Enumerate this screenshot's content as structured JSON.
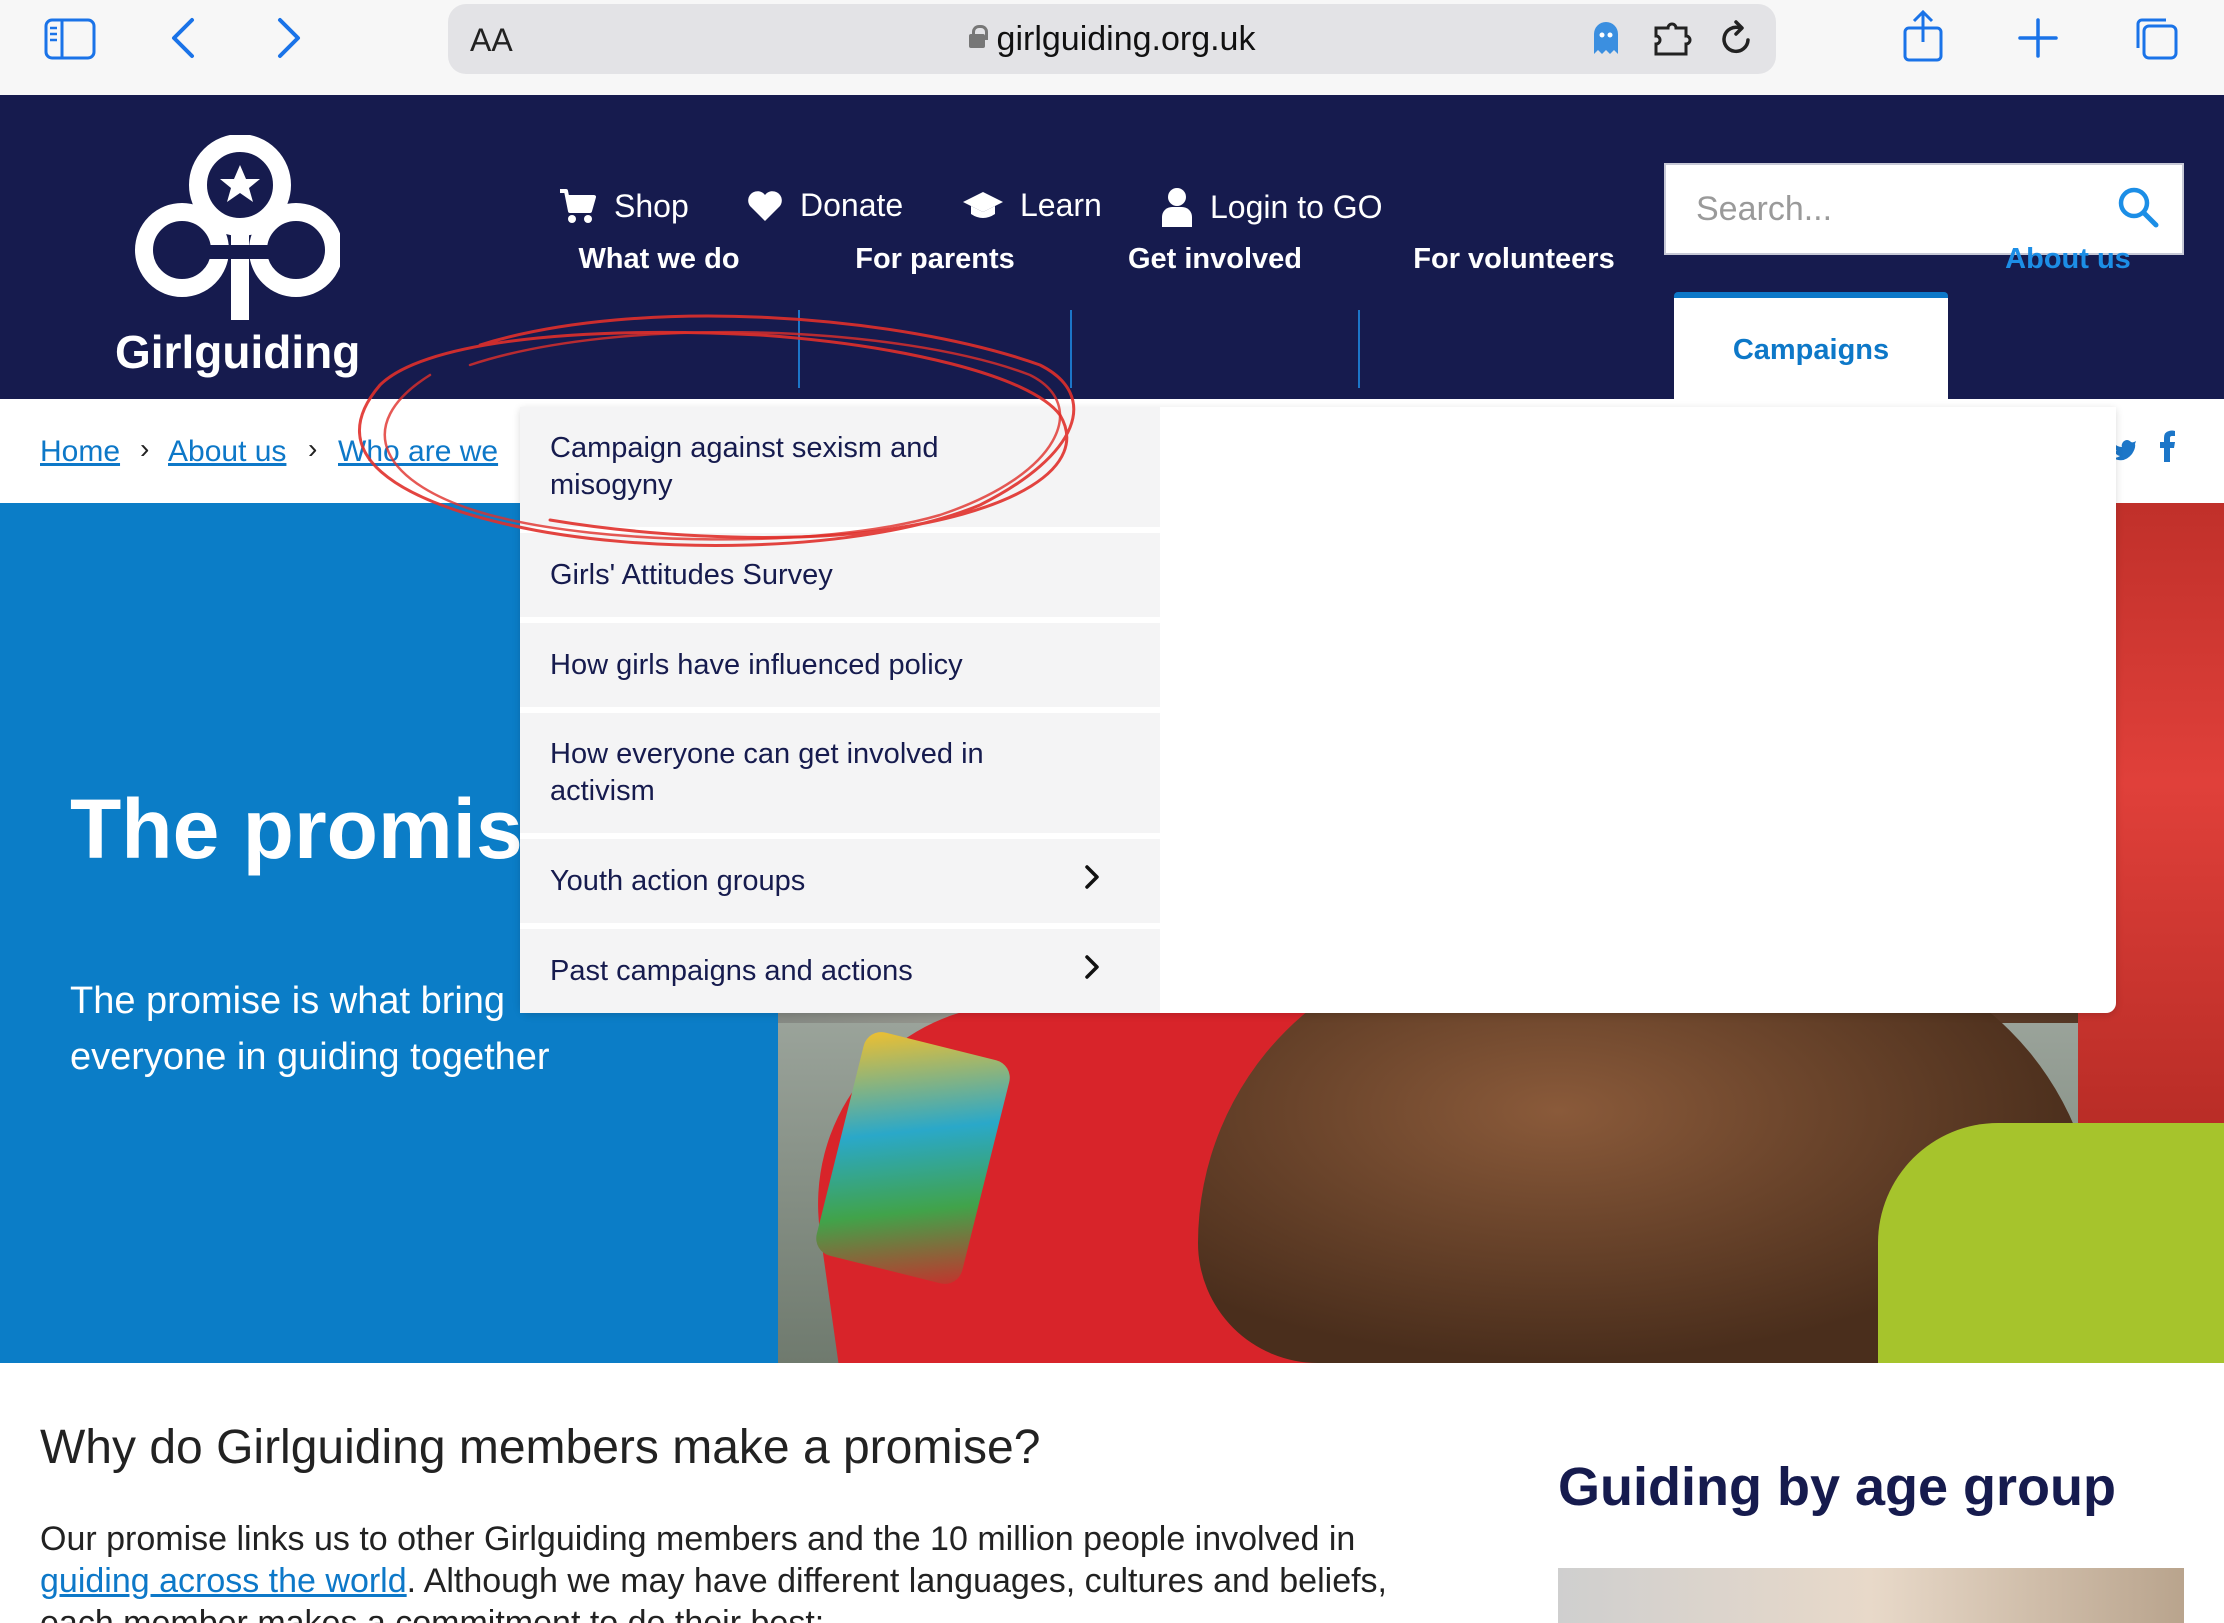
{
  "browser": {
    "aa_label": "AA",
    "url": "girlguiding.org.uk"
  },
  "header": {
    "logo_text": "Girlguiding",
    "util_links": [
      "Shop",
      "Donate",
      "Learn",
      "Login to GO"
    ],
    "search_placeholder": "Search..."
  },
  "nav": {
    "items": [
      "What we do",
      "For parents",
      "Get involved",
      "For volunteers",
      "Campaigns",
      "About us"
    ],
    "active": "Campaigns"
  },
  "breadcrumb": [
    "Home",
    "About us",
    "Who are we"
  ],
  "hero": {
    "title": "The promis",
    "subtitle_line1": "The promise is what bring",
    "subtitle_line2": "everyone in guiding together"
  },
  "dropdown": {
    "items": [
      {
        "label_line1": "Campaign against sexism and",
        "label_line2": "misogyny",
        "has_children": false
      },
      {
        "label_line1": "Girls' Attitudes Survey",
        "label_line2": "",
        "has_children": false
      },
      {
        "label_line1": "How girls have influenced policy",
        "label_line2": "",
        "has_children": false
      },
      {
        "label_line1": "How everyone can get involved in",
        "label_line2": "activism",
        "has_children": false
      },
      {
        "label_line1": "Youth action groups",
        "label_line2": "",
        "has_children": true
      },
      {
        "label_line1": "Past campaigns and actions",
        "label_line2": "",
        "has_children": true
      }
    ]
  },
  "content": {
    "heading": "Why do Girlguiding members make a promise?",
    "para_part1": "Our promise links us to other Girlguiding members and the 10 million people involved in ",
    "para_link": "guiding across the world",
    "para_part2": ". Although we may have different languages, cultures and beliefs, each member makes a commitment to do their best:",
    "side_heading": "Guiding by age group"
  },
  "colors": {
    "navy": "#161b4e",
    "blue": "#0b7dc7",
    "annotation": "#e0302b"
  }
}
